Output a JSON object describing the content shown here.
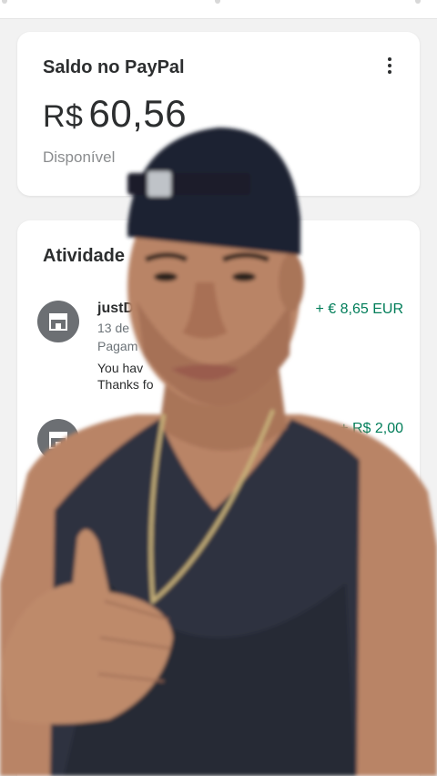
{
  "balance": {
    "title": "Saldo no PayPal",
    "currency": "R$",
    "amount": "60,56",
    "status": "Disponível"
  },
  "activity": {
    "title": "Atividade",
    "transactions": [
      {
        "name": "justD",
        "date": "13 de",
        "type": "Pagam",
        "note_line1": "You hav",
        "note_line2": "Thanks fo",
        "amount": "+ € 8,65 EUR"
      },
      {
        "name": "",
        "date": "",
        "type": "",
        "note_line1": "",
        "note_line2": "",
        "amount": "+ R$ 2,00"
      }
    ]
  },
  "colors": {
    "positive_amount": "#017d59",
    "card_bg": "#ffffff",
    "page_bg": "#f2f2f2",
    "icon_bg": "#6c6f73"
  },
  "icons": {
    "menu": "more-vertical-icon",
    "merchant": "store-icon"
  }
}
